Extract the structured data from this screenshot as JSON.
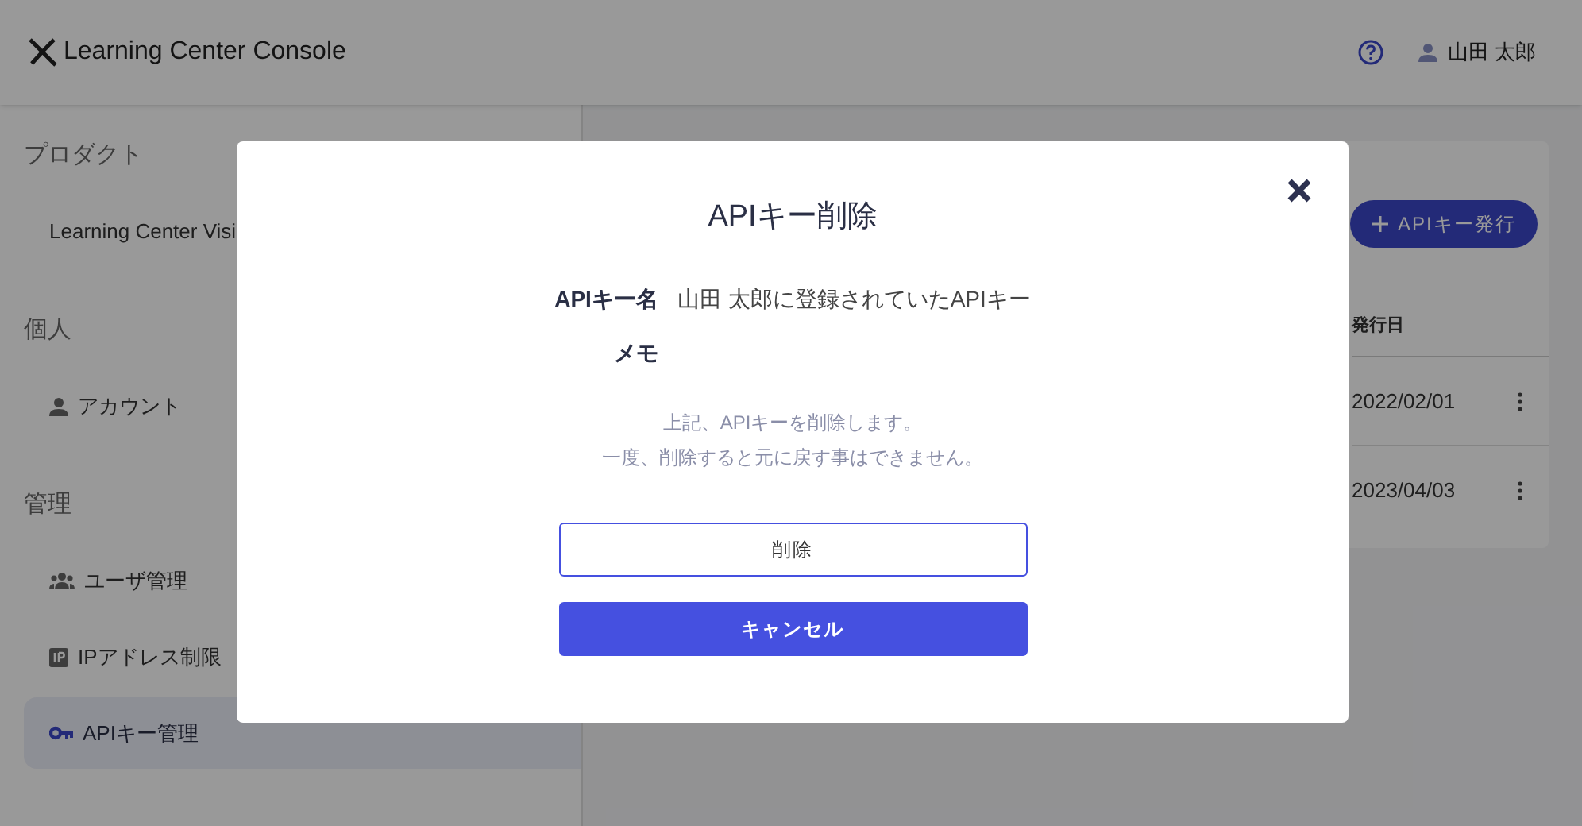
{
  "header": {
    "title": "Learning Center Console",
    "user": "山田 太郎"
  },
  "sidebar": {
    "sections": [
      {
        "heading": "プロダクト",
        "items": [
          {
            "label": "Learning Center Visi",
            "kind": "plain",
            "selected": false
          }
        ]
      },
      {
        "heading": "個人",
        "items": [
          {
            "label": "アカウント",
            "kind": "user",
            "selected": false
          }
        ]
      },
      {
        "heading": "管理",
        "items": [
          {
            "label": "ユーザ管理",
            "kind": "users",
            "selected": false
          },
          {
            "label": "IPアドレス制限",
            "kind": "ip",
            "selected": false
          },
          {
            "label": "APIキー管理",
            "kind": "key",
            "selected": true
          }
        ]
      }
    ]
  },
  "main": {
    "issue_button": "APIキー発行",
    "table": {
      "columns": [
        "発行日"
      ],
      "rows": [
        {
          "cells": [
            "2022/02/01"
          ]
        },
        {
          "cells": [
            "2023/04/03"
          ]
        }
      ]
    }
  },
  "dialog": {
    "title": "APIキー削除",
    "fields": [
      {
        "label": "APIキー名",
        "value": "山田 太郎に登録されていたAPIキー"
      },
      {
        "label": "メモ"
      }
    ],
    "message": [
      "上記、APIキーを削除します。",
      "一度、削除すると元に戻す事はできません。"
    ],
    "buttons": [
      {
        "label": "削除",
        "kind": "outline"
      },
      {
        "label": "キャンセル",
        "kind": "primary"
      }
    ]
  }
}
